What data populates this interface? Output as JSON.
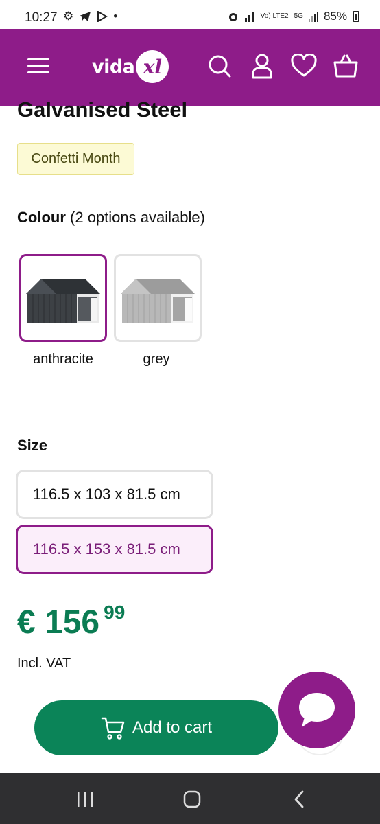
{
  "status_bar": {
    "time": "10:27",
    "battery": "85%",
    "lte_label": "Vo) LTE2",
    "network": "5G",
    "icons": [
      "gear-icon",
      "telegram-icon",
      "play-icon",
      "dot-icon",
      "alarm-icon",
      "signal-icon",
      "battery-icon"
    ]
  },
  "header": {
    "brand": "vida",
    "brand_mark": "xl",
    "icons": [
      "menu-icon",
      "search-icon",
      "account-icon",
      "wishlist-icon",
      "basket-icon"
    ],
    "color": "#8e1c89"
  },
  "product": {
    "title": "Galvanised Steel",
    "badge": "Confetti Month"
  },
  "colour": {
    "label": "Colour",
    "note": "(2 options available)",
    "options": [
      {
        "label": "anthracite",
        "selected": true,
        "shade": "#3d4145"
      },
      {
        "label": "grey",
        "selected": false,
        "shade": "#b8b8b8"
      }
    ]
  },
  "size": {
    "label": "Size",
    "options": [
      {
        "label": "116.5 x 103 x 81.5 cm",
        "selected": false
      },
      {
        "label": "116.5 x 153 x 81.5 cm",
        "selected": true
      }
    ]
  },
  "price": {
    "main": "€ 156",
    "cents": "99",
    "vat": "Incl. VAT",
    "color": "#0b7c53"
  },
  "actions": {
    "add_to_cart": "Add to cart",
    "accent": "#0b8458"
  },
  "nav": {
    "icons": [
      "recent-apps-icon",
      "home-icon",
      "back-icon"
    ]
  }
}
